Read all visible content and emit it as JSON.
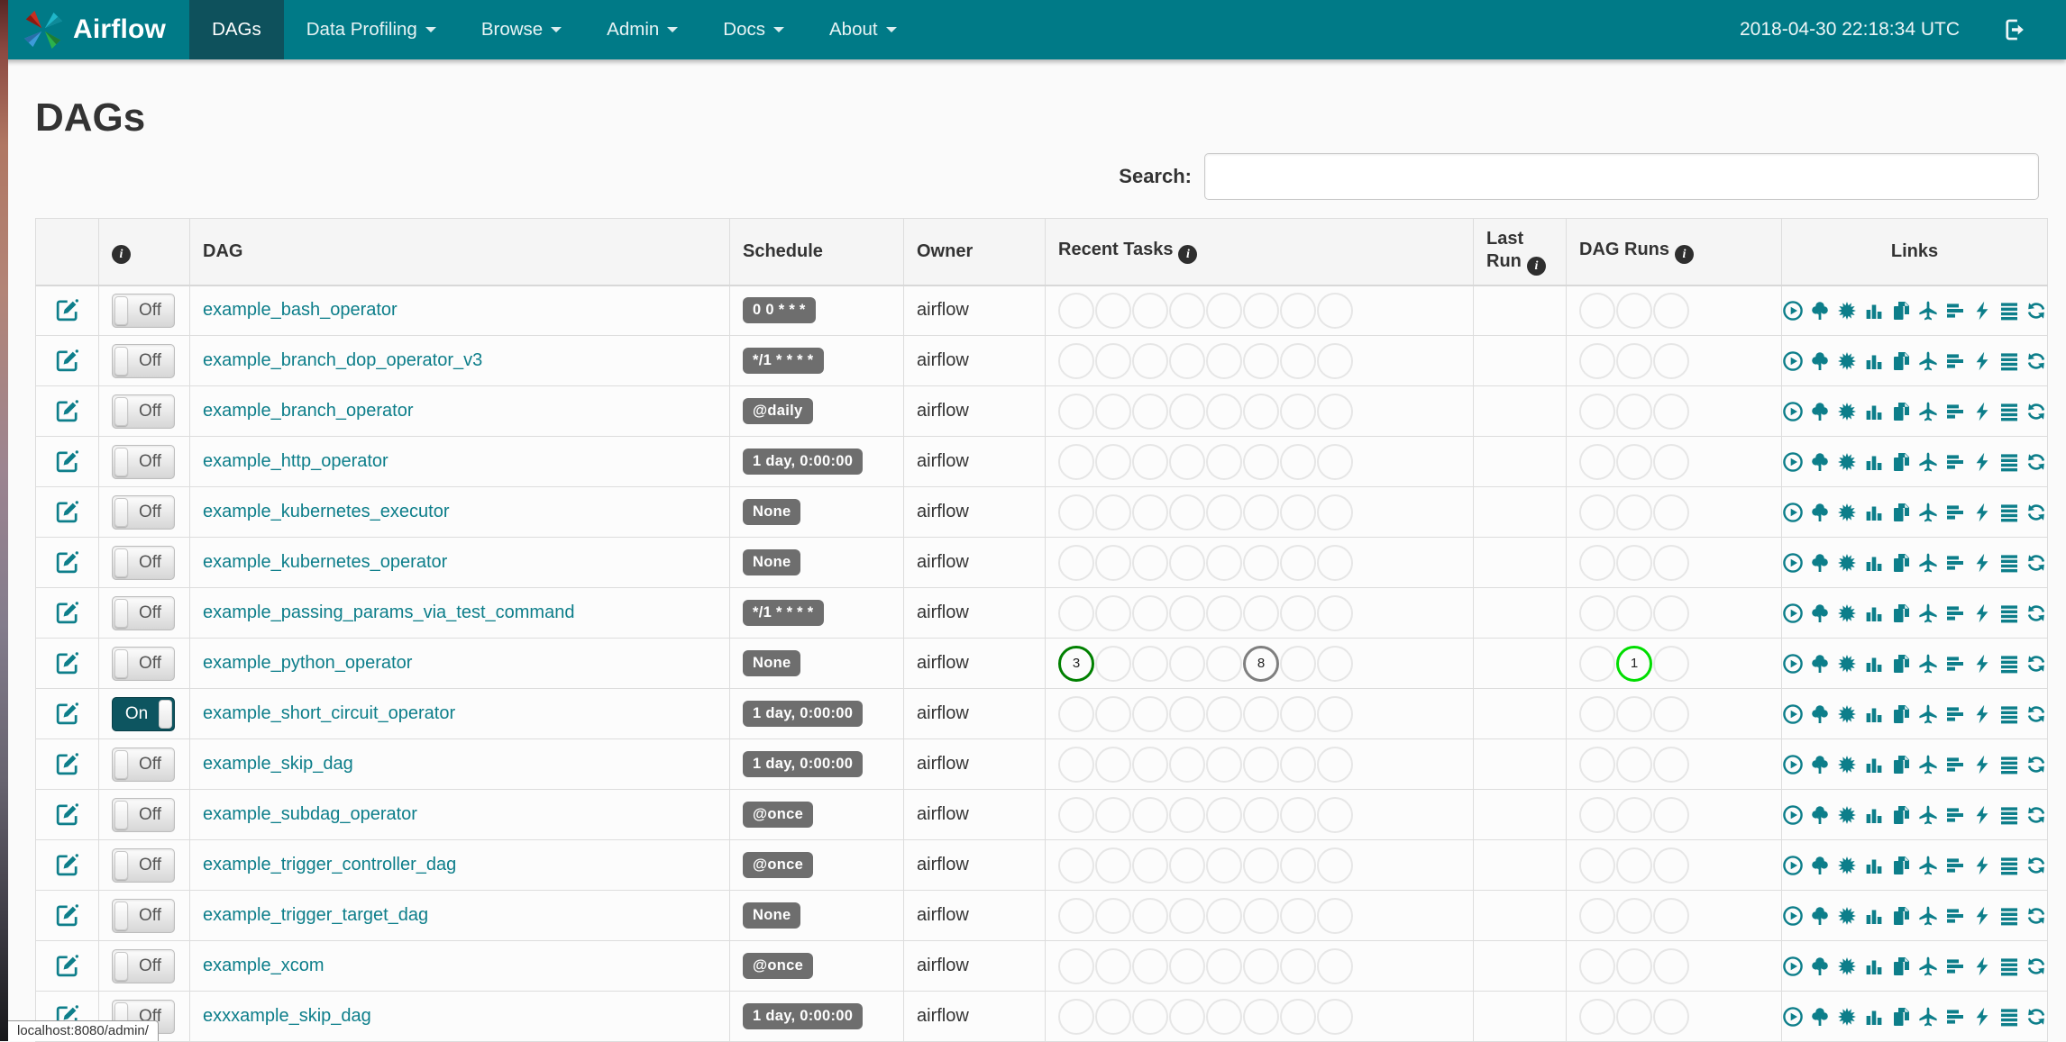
{
  "navbar": {
    "brand": "Airflow",
    "items": [
      {
        "label": "DAGs",
        "active": true,
        "dropdown": false
      },
      {
        "label": "Data Profiling",
        "active": false,
        "dropdown": true
      },
      {
        "label": "Browse",
        "active": false,
        "dropdown": true
      },
      {
        "label": "Admin",
        "active": false,
        "dropdown": true
      },
      {
        "label": "Docs",
        "active": false,
        "dropdown": true
      },
      {
        "label": "About",
        "active": false,
        "dropdown": true
      }
    ],
    "clock": "2018-04-30 22:18:34 UTC"
  },
  "page": {
    "title": "DAGs"
  },
  "search": {
    "label": "Search:",
    "value": "",
    "placeholder": ""
  },
  "toggle": {
    "on_label": "On",
    "off_label": "Off"
  },
  "table": {
    "headers": {
      "dag": "DAG",
      "schedule": "Schedule",
      "owner": "Owner",
      "recent_tasks": "Recent Tasks",
      "last_run": "Last Run",
      "dag_runs": "DAG Runs",
      "links": "Links"
    },
    "recent_task_slots": 8,
    "dag_run_slots": 3
  },
  "links": [
    {
      "icon": "play",
      "name": "trigger-dag"
    },
    {
      "icon": "tree",
      "name": "tree-view"
    },
    {
      "icon": "burst",
      "name": "graph-view"
    },
    {
      "icon": "bars",
      "name": "task-duration"
    },
    {
      "icon": "copy",
      "name": "task-tries"
    },
    {
      "icon": "plane",
      "name": "landing-times"
    },
    {
      "icon": "gantt",
      "name": "gantt-view"
    },
    {
      "icon": "bolt",
      "name": "code-view"
    },
    {
      "icon": "justify",
      "name": "logs"
    },
    {
      "icon": "refresh",
      "name": "refresh-dag"
    }
  ],
  "colors": {
    "navbar": "#007a87",
    "navbar_active": "#0e515c",
    "accent_teal": "#0d7e8a",
    "badge_gray": "#6e6e6e",
    "success": "#008000",
    "running": "#00dd00",
    "queued": "#7f7f7f",
    "empty_circle": "#e6e6e6"
  },
  "dags": [
    {
      "name": "example_bash_operator",
      "schedule": "0 0 * * *",
      "owner": "airflow",
      "on": false,
      "recent_tasks": [],
      "dag_runs": []
    },
    {
      "name": "example_branch_dop_operator_v3",
      "schedule": "*/1 * * * *",
      "owner": "airflow",
      "on": false,
      "recent_tasks": [],
      "dag_runs": []
    },
    {
      "name": "example_branch_operator",
      "schedule": "@daily",
      "owner": "airflow",
      "on": false,
      "recent_tasks": [],
      "dag_runs": []
    },
    {
      "name": "example_http_operator",
      "schedule": "1 day, 0:00:00",
      "owner": "airflow",
      "on": false,
      "recent_tasks": [],
      "dag_runs": []
    },
    {
      "name": "example_kubernetes_executor",
      "schedule": "None",
      "owner": "airflow",
      "on": false,
      "recent_tasks": [],
      "dag_runs": []
    },
    {
      "name": "example_kubernetes_operator",
      "schedule": "None",
      "owner": "airflow",
      "on": false,
      "recent_tasks": [],
      "dag_runs": []
    },
    {
      "name": "example_passing_params_via_test_command",
      "schedule": "*/1 * * * *",
      "owner": "airflow",
      "on": false,
      "recent_tasks": [],
      "dag_runs": []
    },
    {
      "name": "example_python_operator",
      "schedule": "None",
      "owner": "airflow",
      "on": false,
      "recent_tasks": [
        {
          "slot": 1,
          "state": "success",
          "count": 3
        },
        {
          "slot": 6,
          "state": "queued",
          "count": 8
        }
      ],
      "dag_runs": [
        {
          "slot": 2,
          "state": "running",
          "count": 1
        }
      ]
    },
    {
      "name": "example_short_circuit_operator",
      "schedule": "1 day, 0:00:00",
      "owner": "airflow",
      "on": true,
      "recent_tasks": [],
      "dag_runs": []
    },
    {
      "name": "example_skip_dag",
      "schedule": "1 day, 0:00:00",
      "owner": "airflow",
      "on": false,
      "recent_tasks": [],
      "dag_runs": []
    },
    {
      "name": "example_subdag_operator",
      "schedule": "@once",
      "owner": "airflow",
      "on": false,
      "recent_tasks": [],
      "dag_runs": []
    },
    {
      "name": "example_trigger_controller_dag",
      "schedule": "@once",
      "owner": "airflow",
      "on": false,
      "recent_tasks": [],
      "dag_runs": []
    },
    {
      "name": "example_trigger_target_dag",
      "schedule": "None",
      "owner": "airflow",
      "on": false,
      "recent_tasks": [],
      "dag_runs": []
    },
    {
      "name": "example_xcom",
      "schedule": "@once",
      "owner": "airflow",
      "on": false,
      "recent_tasks": [],
      "dag_runs": []
    },
    {
      "name": "exxxample_skip_dag",
      "schedule": "1 day, 0:00:00",
      "owner": "airflow",
      "on": false,
      "recent_tasks": [],
      "dag_runs": []
    }
  ],
  "status_bar": {
    "text": "localhost:8080/admin/"
  }
}
